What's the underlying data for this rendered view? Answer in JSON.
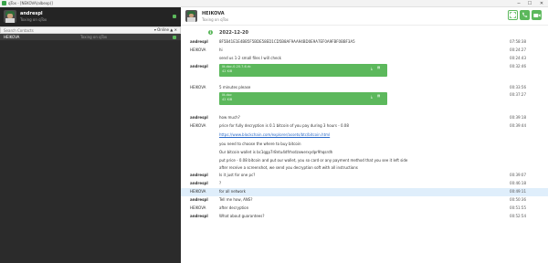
{
  "window": {
    "title": "qTox - [NEKOVA(albexp)]",
    "buttons": {
      "minimize": "─",
      "maximize": "☐",
      "close": "✕"
    }
  },
  "profile": {
    "name": "andrespl",
    "status": "Toxing on qTox"
  },
  "search": {
    "placeholder": "Search Contacts",
    "filter_label": "▾ Online",
    "clear_label": "▲ ✕"
  },
  "contacts": [
    {
      "name": "HEIKOVA",
      "status": "Toxing on qTox"
    }
  ],
  "chat": {
    "contact_name": "HEIKOVA",
    "contact_status": "Toxing on qTox",
    "date": "2022-12-20",
    "messages": [
      {
        "sender": "andrespl",
        "text": "8F5B41E1E4BB5F5BDE58ED1CD5B8AF9AA94BD0E9A7EF0A9FBF0BBF3A5",
        "time": "07:58:38"
      },
      {
        "sender": "HEIKOVA",
        "text": "hi",
        "time": "00:24:27"
      },
      {
        "sender": "",
        "text": "send us 1-2 small files I will check",
        "time": "00:24:43"
      },
      {
        "sender": "andrespl",
        "file": {
          "name": "lit-doc-0-20.7.6.rb",
          "size": "42 KiB"
        },
        "time": "00:32:46"
      },
      {
        "sender": "HEIKOVA",
        "text": "5 minutes please",
        "time": "00:33:56"
      },
      {
        "sender": "",
        "file": {
          "name": "lit-doc",
          "size": "42 KiB"
        },
        "time": "00:37:27"
      },
      {
        "sender": "andrespl",
        "text": "how much?",
        "time": "00:39:18"
      },
      {
        "sender": "HEIKOVA",
        "text": "price for fully decryption is 0.1 bitcoin of you pay during 3 hours - 0.08",
        "time": "00:39:44"
      },
      {
        "sender": "",
        "text": "https://www.blockchain.com/explorer/assets/btc/bitcoin.html",
        "link": true,
        "time": ""
      },
      {
        "sender": "",
        "text": "you need to choose the where to buy bitcoin",
        "time": ""
      },
      {
        "sender": "",
        "text": "Our bitcoin wallet is bc1qgp7r8ntu4dfrhsdzxwerxydpr9hqsrdh",
        "time": ""
      },
      {
        "sender": "",
        "text": "put price - 0.08 bitcoin and put our wallet, you so card or any payment method that you see it left side",
        "time": ""
      },
      {
        "sender": "",
        "text": "after receive a screenshot, we send you decryption soft with all instructions",
        "time": ""
      },
      {
        "sender": "andrespl",
        "text": "Is it just for one pc?",
        "time": "00:39:07"
      },
      {
        "sender": "andrespl",
        "text": "?",
        "time": "00:46:18"
      },
      {
        "sender": "HEIKOVA",
        "text": "for all network",
        "time": "00:49:11",
        "highlight": true
      },
      {
        "sender": "andrespl",
        "text": "Tell me how, ANS?",
        "time": "00:50:36"
      },
      {
        "sender": "HEIKOVA",
        "text": "after decryption",
        "time": "00:51:55"
      },
      {
        "sender": "andrespl",
        "text": "What about guarantees?",
        "time": "00:52:54"
      }
    ]
  },
  "colors": {
    "accent": "#5cb85c",
    "sidebar": "#2b2b2b",
    "highlight": "#dfeefb"
  },
  "icons": {
    "header_buttons": [
      "fullscreen-icon",
      "phone-icon",
      "video-call-icon"
    ],
    "day": "info-icon"
  }
}
